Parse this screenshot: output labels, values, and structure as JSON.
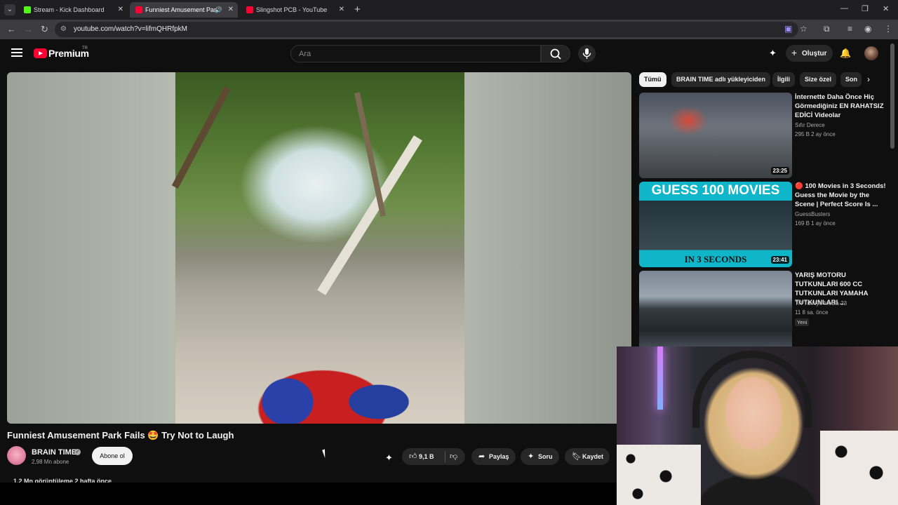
{
  "browser": {
    "tabs": [
      {
        "title": "Stream - Kick Dashboard",
        "active": false
      },
      {
        "title": "Funniest Amusement Park",
        "active": true
      },
      {
        "title": "Slingshot PCB - YouTube",
        "active": false
      }
    ],
    "url": "youtube.com/watch?v=lifmQHRfpkM"
  },
  "header": {
    "logo_text": "Premium",
    "logo_region": "TR",
    "search_placeholder": "Ara",
    "create_label": "Oluştur"
  },
  "video": {
    "title": "Funniest Amusement Park Fails 🤩 Try Not to Laugh",
    "channel": "BRAIN TIME",
    "subscribers": "2,98 Mn abone",
    "subscribe_label": "Abone ol",
    "likes": "9,1 B",
    "share_label": "Paylaş",
    "ask_label": "Soru",
    "save_label": "Kaydet",
    "views_line": "1,2 Mn görüntüleme  2 hafta önce"
  },
  "sidebar": {
    "chips": [
      "Tümü",
      "BRAIN TIME adlı yükleyiciden",
      "İlgili",
      "Size özel",
      "Son"
    ],
    "recommendations": [
      {
        "title": "İnternette Daha Önce Hiç Görmediğiniz EN RAHATSIZ EDİCİ Videolar",
        "channel": "Sıfır Derece",
        "meta": "295 B  2 ay önce",
        "duration": "23:25",
        "badge": ""
      },
      {
        "title": "🔴 100 Movies in 3 Seconds! Guess the Movie by the Scene | Perfect Score Is ...",
        "channel": "GuessBusters",
        "meta": "169 B  1 ay önce",
        "duration": "23:41",
        "badge": "",
        "thumb_top": "GUESS 100 MOVIES",
        "thumb_bottom": "IN 3 SECONDS"
      },
      {
        "title": "YARIŞ MOTORU TUTKUNLARI 600 CC TUTKUNLARI YAMAHA TUTKUNLARI ...",
        "channel": "TR Türkiye Media 23",
        "meta": "11  8 sa. önce",
        "duration": "",
        "badge": "Yeni"
      }
    ]
  },
  "colors": {
    "brand_red": "#ff0033",
    "background": "#0f0f0f",
    "chip_bg": "#272727"
  },
  "icons": [
    "menu-icon",
    "search-icon",
    "mic-icon",
    "cast-icon",
    "bell-icon",
    "like-icon",
    "dislike-icon",
    "share-icon",
    "sparkle-icon",
    "bookmark-icon"
  ]
}
